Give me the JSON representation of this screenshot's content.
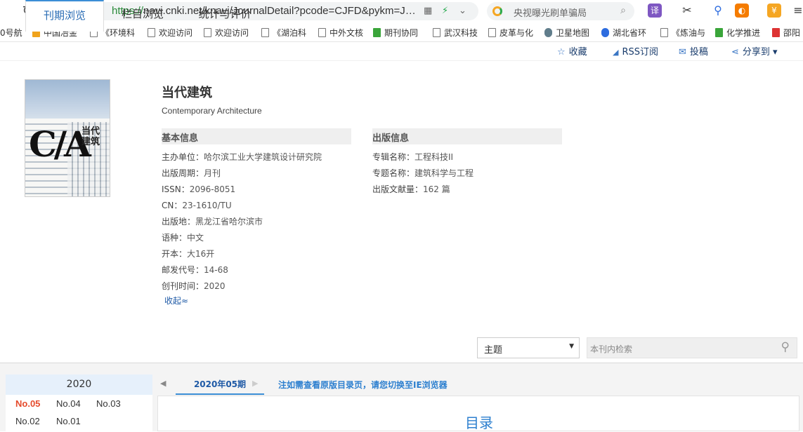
{
  "browser": {
    "url_proto": "https://",
    "url_rest": "navi.cnki.net/knavi/JournalDetail?pcode=CJFD&pykm=J…",
    "search_placeholder": "央视曝光刷单骗局",
    "ext_translate": "译",
    "ext_money": "¥"
  },
  "bookmarks": [
    {
      "label": "0号航",
      "icon": "page-icon"
    },
    {
      "label": "中国冶金",
      "icon": "yellow-logo-icon"
    },
    {
      "label": "《环境科",
      "icon": "page-icon"
    },
    {
      "label": "欢迎访问",
      "icon": "page-icon"
    },
    {
      "label": "欢迎访问",
      "icon": "page-icon"
    },
    {
      "label": "《湖泊科",
      "icon": "page-icon"
    },
    {
      "label": "中外文核",
      "icon": "page-icon"
    },
    {
      "label": "期刊协同",
      "icon": "green-logo-icon"
    },
    {
      "label": "武汉科技",
      "icon": "page-icon"
    },
    {
      "label": "皮革与化",
      "icon": "page-icon"
    },
    {
      "label": "卫星地图",
      "icon": "globe-icon"
    },
    {
      "label": "湖北省环",
      "icon": "paw-icon"
    },
    {
      "label": "《炼油与",
      "icon": "page-icon"
    },
    {
      "label": "化学推进",
      "icon": "green-logo-icon"
    },
    {
      "label": "邵阳",
      "icon": "red-logo-icon"
    }
  ],
  "toplinks": {
    "favorite": "收藏",
    "rss": "RSS订阅",
    "submit": "投稿",
    "share": "分享到 ▾"
  },
  "journal": {
    "title": "当代建筑",
    "title_en": "Contemporary Architecture",
    "cover_logo": "C/A",
    "cover_cn": "当代建筑"
  },
  "basic_info": {
    "heading": "基本信息",
    "rows": [
      {
        "label": "主办单位：",
        "value": "哈尔滨工业大学建筑设计研究院"
      },
      {
        "label": "出版周期：",
        "value": "月刊"
      },
      {
        "label": "ISSN：",
        "value": "2096-8051"
      },
      {
        "label": "CN：",
        "value": "23-1610/TU"
      },
      {
        "label": "出版地：",
        "value": "黑龙江省哈尔滨市"
      },
      {
        "label": "语种：",
        "value": "中文"
      },
      {
        "label": "开本：",
        "value": "大16开"
      },
      {
        "label": "邮发代号：",
        "value": "14-68"
      },
      {
        "label": "创刊时间：",
        "value": "2020"
      }
    ],
    "collapse": "收起≈"
  },
  "pub_info": {
    "heading": "出版信息",
    "rows": [
      {
        "label": "专辑名称：",
        "value": "工程科技II"
      },
      {
        "label": "专题名称：",
        "value": "建筑科学与工程"
      },
      {
        "label": "出版文献量：",
        "value": "162 篇"
      }
    ]
  },
  "tabs": [
    {
      "label": "刊期浏览",
      "active": true
    },
    {
      "label": "栏目浏览",
      "active": false
    },
    {
      "label": "统计与评价",
      "active": false
    }
  ],
  "search": {
    "field_select": "主题",
    "placeholder": "本刊内检索"
  },
  "issues": {
    "year": "2020",
    "list": [
      "No.05",
      "No.04",
      "No.03",
      "No.02",
      "No.01"
    ],
    "selected": "No.05",
    "current_issue": "2020年05期",
    "note": "注如需查看原版目录页，请您切换至IE浏览器",
    "toc_title": "目录"
  },
  "colors": {
    "accent_blue": "#3b8ed6",
    "link_blue": "#1f5aa6",
    "selected_issue": "#e54b2c"
  }
}
